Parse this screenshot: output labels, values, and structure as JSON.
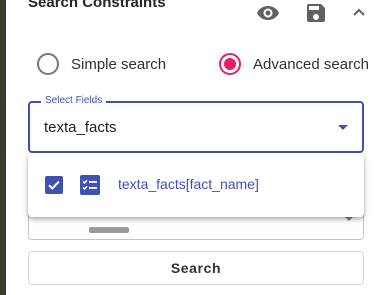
{
  "panel": {
    "title": "Search Constraints",
    "icons": [
      "eye-icon",
      "save-icon",
      "chevron-up-icon"
    ]
  },
  "mode": {
    "options": [
      {
        "label": "Simple search",
        "selected": false
      },
      {
        "label": "Advanced search",
        "selected": true
      }
    ]
  },
  "select_fields": {
    "label": "Select Fields",
    "value": "texta_facts"
  },
  "dropdown": {
    "items": [
      {
        "label": "texta_facts[fact_name]",
        "checked": true,
        "icon": "fact-list-icon"
      }
    ]
  },
  "search_button": {
    "label": "Search"
  },
  "colors": {
    "primary": "#3f51b5",
    "accent": "#e91e63",
    "left_strip": "#3a3a2e"
  }
}
